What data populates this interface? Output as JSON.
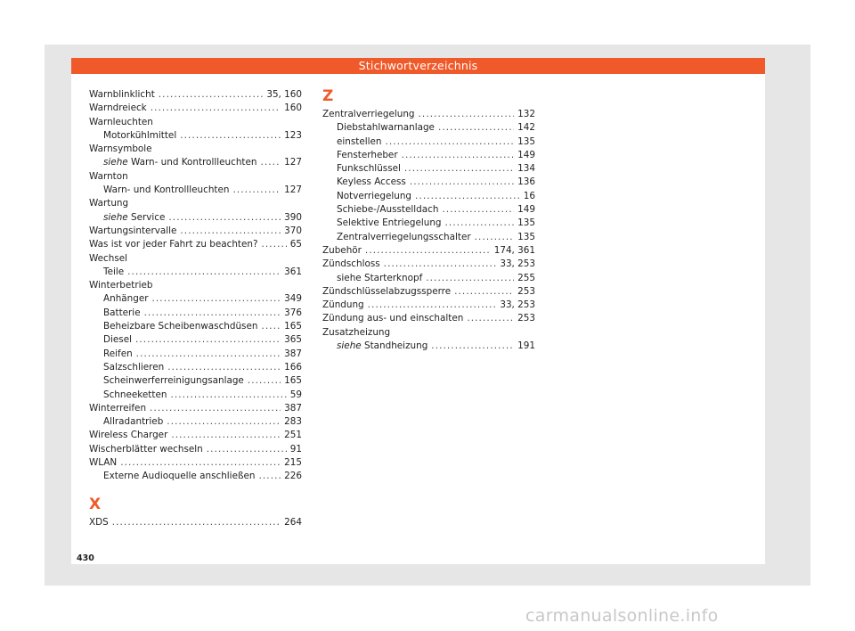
{
  "header": {
    "title": "Stichwortverzeichnis"
  },
  "page_number": "430",
  "watermark": "carmanualsonline.info",
  "left_column": [
    {
      "term": "Warnblinklicht",
      "pages": "35, 160"
    },
    {
      "term": "Warndreieck",
      "pages": "160"
    },
    {
      "term": "Warnleuchten",
      "pages": ""
    },
    {
      "sub": true,
      "term": "Motorkühlmittel",
      "pages": "123"
    },
    {
      "term": "Warnsymbole",
      "pages": ""
    },
    {
      "sub": true,
      "see": "siehe",
      "term": "Warn- und Kontrollleuchten",
      "pages": "127"
    },
    {
      "term": "Warnton",
      "pages": ""
    },
    {
      "sub": true,
      "term": "Warn- und Kontrollleuchten",
      "pages": "127"
    },
    {
      "term": "Wartung",
      "pages": ""
    },
    {
      "sub": true,
      "see": "siehe",
      "term": "Service",
      "pages": "390"
    },
    {
      "term": "Wartungsintervalle",
      "pages": "370"
    },
    {
      "term": "Was ist vor jeder Fahrt zu beachten?",
      "pages": "65"
    },
    {
      "term": "Wechsel",
      "pages": ""
    },
    {
      "sub": true,
      "term": "Teile",
      "pages": "361"
    },
    {
      "term": "Winterbetrieb",
      "pages": ""
    },
    {
      "sub": true,
      "term": "Anhänger",
      "pages": "349"
    },
    {
      "sub": true,
      "term": "Batterie",
      "pages": "376"
    },
    {
      "sub": true,
      "term": "Beheizbare Scheibenwaschdüsen",
      "pages": "165"
    },
    {
      "sub": true,
      "term": "Diesel",
      "pages": "365"
    },
    {
      "sub": true,
      "term": "Reifen",
      "pages": "387"
    },
    {
      "sub": true,
      "term": "Salzschlieren",
      "pages": "166"
    },
    {
      "sub": true,
      "term": "Scheinwerferreinigungsanlage",
      "pages": "165"
    },
    {
      "sub": true,
      "term": "Schneeketten",
      "pages": "59"
    },
    {
      "term": "Winterreifen",
      "pages": "387"
    },
    {
      "sub": true,
      "term": "Allradantrieb",
      "pages": "283"
    },
    {
      "term": "Wireless Charger",
      "pages": "251"
    },
    {
      "term": "Wischerblätter wechseln",
      "pages": "91"
    },
    {
      "term": "WLAN",
      "pages": "215"
    },
    {
      "sub": true,
      "term": "Externe Audioquelle anschließen",
      "pages": "226"
    }
  ],
  "letter_x": "X",
  "x_entries": [
    {
      "term": "XDS",
      "pages": "264"
    }
  ],
  "letter_z": "Z",
  "z_entries": [
    {
      "term": "Zentralverriegelung",
      "pages": "132"
    },
    {
      "sub": true,
      "term": "Diebstahlwarnanlage",
      "pages": "142"
    },
    {
      "sub": true,
      "term": "einstellen",
      "pages": "135"
    },
    {
      "sub": true,
      "term": "Fensterheber",
      "pages": "149"
    },
    {
      "sub": true,
      "term": "Funkschlüssel",
      "pages": "134"
    },
    {
      "sub": true,
      "term": "Keyless Access",
      "pages": "136"
    },
    {
      "sub": true,
      "term": "Notverriegelung",
      "pages": "16"
    },
    {
      "sub": true,
      "term": "Schiebe-/Ausstelldach",
      "pages": "149"
    },
    {
      "sub": true,
      "term": "Selektive Entriegelung",
      "pages": "135"
    },
    {
      "sub": true,
      "term": "Zentralverriegelungsschalter",
      "pages": "135"
    },
    {
      "term": "Zubehör",
      "pages": "174, 361"
    },
    {
      "term": "Zündschloss",
      "pages": "33, 253"
    },
    {
      "sub": true,
      "term": "siehe Starterknopf",
      "pages": "255"
    },
    {
      "term": "Zündschlüsselabzugssperre",
      "pages": "253"
    },
    {
      "term": "Zündung",
      "pages": "33, 253"
    },
    {
      "term": "Zündung aus- und einschalten",
      "pages": "253"
    },
    {
      "term": "Zusatzheizung",
      "pages": ""
    },
    {
      "sub": true,
      "see": "siehe",
      "term": "Standheizung",
      "pages": "191"
    }
  ]
}
